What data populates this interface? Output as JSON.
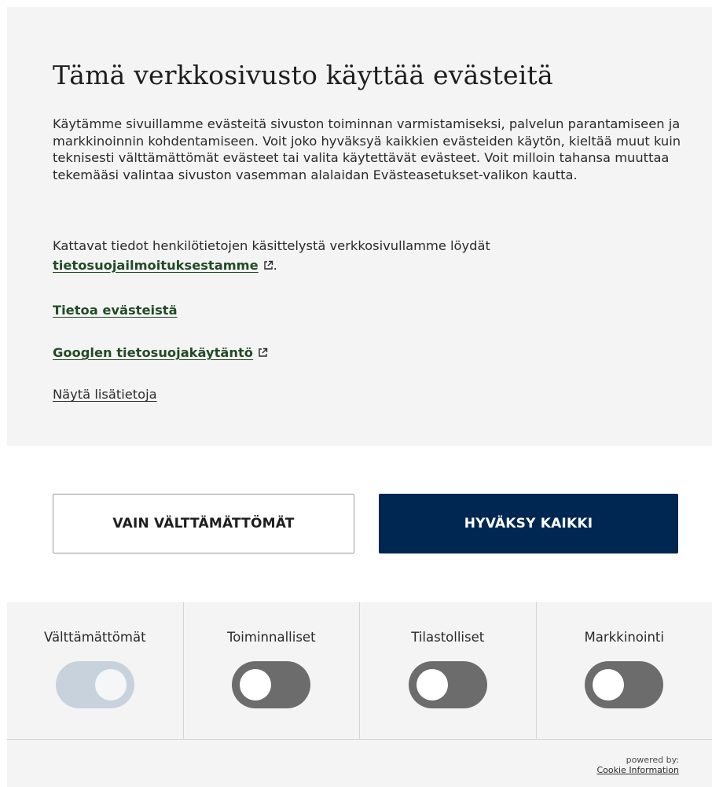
{
  "banner": {
    "title": "Tämä verkkosivusto käyttää evästeitä",
    "description": "Käytämme sivuillamme evästeitä sivuston toiminnan varmistamiseksi, palvelun parantamiseen ja markkinoinnin kohdentamiseen. Voit joko hyväksyä kaikkien evästeiden käytön, kieltää muut kuin teknisesti välttämättömät evästeet tai valita käytettävät evästeet. Voit milloin tahansa muuttaa tekemääsi valintaa sivuston vasemman alalaidan Evästeasetukset-valikon kautta.",
    "policy_text": "Kattavat tiedot henkilötietojen käsittelystä verkkosivullamme löydät",
    "policy_link": "tietosuojailmoituksestamme",
    "policy_suffix": ".",
    "cookies_link": "Tietoa evästeistä",
    "google_link": "Googlen tietosuojakäytäntö",
    "more_link": "Näytä lisätietoja",
    "link_color": "#234a26",
    "external_icon": "external-link-icon"
  },
  "buttons": {
    "necessary_label": "VAIN VÄLTTÄMÄTTÖMÄT",
    "accept_label": "HYVÄKSY KAIKKI",
    "accept_color": "#002752"
  },
  "categories": [
    {
      "label": "Välttämättömät",
      "enabled": true,
      "locked": true
    },
    {
      "label": "Toiminnalliset",
      "enabled": false,
      "locked": false
    },
    {
      "label": "Tilastolliset",
      "enabled": false,
      "locked": false
    },
    {
      "label": "Markkinointi",
      "enabled": false,
      "locked": false
    }
  ],
  "footer": {
    "powered_by": "powered by:",
    "provider_link": "Cookie Information"
  }
}
